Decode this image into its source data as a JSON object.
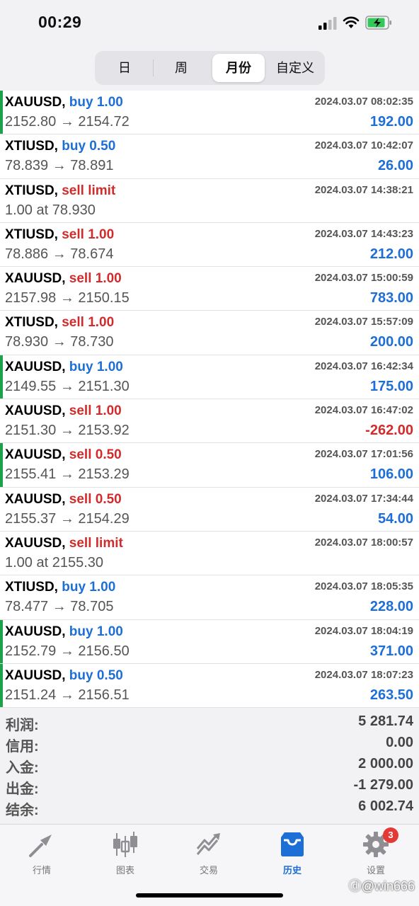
{
  "status": {
    "time": "00:29"
  },
  "tabs": [
    "日",
    "周",
    "月份",
    "自定义"
  ],
  "trades": [
    {
      "symbol": "XAUUSD,",
      "action": "buy 1.00",
      "side": "buy",
      "datetime": "2024.03.07 08:02:35",
      "prices": "2152.80 → 2154.72",
      "profit": "192.00",
      "mark": true
    },
    {
      "symbol": "XTIUSD,",
      "action": "buy 0.50",
      "side": "buy",
      "datetime": "2024.03.07 10:42:07",
      "prices": "78.839 → 78.891",
      "profit": "26.00",
      "mark": false
    },
    {
      "symbol": "XTIUSD,",
      "action": "sell limit",
      "side": "sell",
      "datetime": "2024.03.07 14:38:21",
      "prices": "1.00 at 78.930",
      "profit": "",
      "mark": false
    },
    {
      "symbol": "XTIUSD,",
      "action": "sell 1.00",
      "side": "sell",
      "datetime": "2024.03.07 14:43:23",
      "prices": "78.886 → 78.674",
      "profit": "212.00",
      "mark": false
    },
    {
      "symbol": "XAUUSD,",
      "action": "sell 1.00",
      "side": "sell",
      "datetime": "2024.03.07 15:00:59",
      "prices": "2157.98 → 2150.15",
      "profit": "783.00",
      "mark": false
    },
    {
      "symbol": "XTIUSD,",
      "action": "sell 1.00",
      "side": "sell",
      "datetime": "2024.03.07 15:57:09",
      "prices": "78.930 → 78.730",
      "profit": "200.00",
      "mark": false
    },
    {
      "symbol": "XAUUSD,",
      "action": "buy 1.00",
      "side": "buy",
      "datetime": "2024.03.07 16:42:34",
      "prices": "2149.55 → 2151.30",
      "profit": "175.00",
      "mark": true
    },
    {
      "symbol": "XAUUSD,",
      "action": "sell 1.00",
      "side": "sell",
      "datetime": "2024.03.07 16:47:02",
      "prices": "2151.30 → 2153.92",
      "profit": "-262.00",
      "mark": false
    },
    {
      "symbol": "XAUUSD,",
      "action": "sell 0.50",
      "side": "sell",
      "datetime": "2024.03.07 17:01:56",
      "prices": "2155.41 → 2153.29",
      "profit": "106.00",
      "mark": true
    },
    {
      "symbol": "XAUUSD,",
      "action": "sell 0.50",
      "side": "sell",
      "datetime": "2024.03.07 17:34:44",
      "prices": "2155.37 → 2154.29",
      "profit": "54.00",
      "mark": false
    },
    {
      "symbol": "XAUUSD,",
      "action": "sell limit",
      "side": "sell",
      "datetime": "2024.03.07 18:00:57",
      "prices": "1.00 at 2155.30",
      "profit": "",
      "mark": false
    },
    {
      "symbol": "XTIUSD,",
      "action": "buy 1.00",
      "side": "buy",
      "datetime": "2024.03.07 18:05:35",
      "prices": "78.477 → 78.705",
      "profit": "228.00",
      "mark": false
    },
    {
      "symbol": "XAUUSD,",
      "action": "buy 1.00",
      "side": "buy",
      "datetime": "2024.03.07 18:04:19",
      "prices": "2152.79 → 2156.50",
      "profit": "371.00",
      "mark": true
    },
    {
      "symbol": "XAUUSD,",
      "action": "buy 0.50",
      "side": "buy",
      "datetime": "2024.03.07 18:07:23",
      "prices": "2151.24 → 2156.51",
      "profit": "263.50",
      "mark": true
    }
  ],
  "summary": [
    {
      "label": "利润:",
      "value": "5 281.74"
    },
    {
      "label": "信用:",
      "value": "0.00"
    },
    {
      "label": "入金:",
      "value": "2 000.00"
    },
    {
      "label": "出金:",
      "value": "-1 279.00"
    },
    {
      "label": "结余:",
      "value": "6 002.74"
    }
  ],
  "tabbar": [
    {
      "label": "行情",
      "icon": "quotes-icon"
    },
    {
      "label": "图表",
      "icon": "chart-icon"
    },
    {
      "label": "交易",
      "icon": "trade-icon"
    },
    {
      "label": "历史",
      "icon": "history-icon"
    },
    {
      "label": "设置",
      "icon": "settings-icon",
      "badge": "3"
    }
  ],
  "colors": {
    "buy": "#1d6fd6",
    "sell": "#d12c2c",
    "profit": "#1d6fd6",
    "loss": "#d12c2c",
    "active_tab": "#1d6fd6",
    "mark": "#1ea14a"
  },
  "watermark": "ⓓ@win666"
}
